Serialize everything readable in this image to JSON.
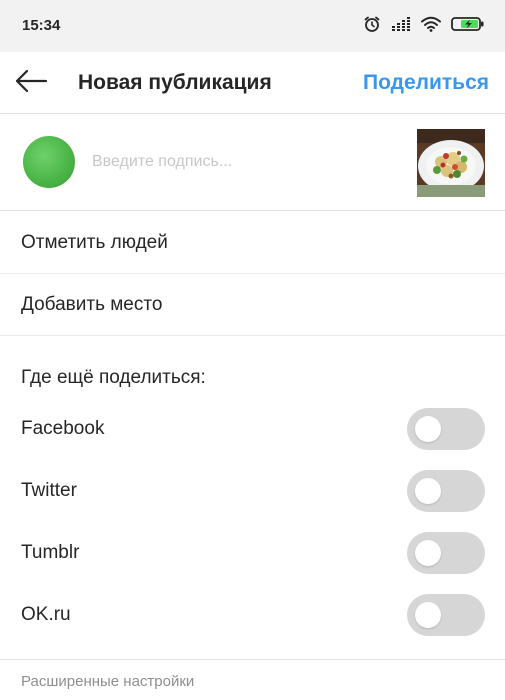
{
  "status_bar": {
    "time": "15:34",
    "icons": [
      "alarm-icon",
      "signal-icon",
      "wifi-icon",
      "battery-charging-icon"
    ]
  },
  "header": {
    "back_icon": "arrow-left-icon",
    "title": "Новая публикация",
    "share_label": "Поделиться",
    "accent_color": "#3897f0"
  },
  "caption": {
    "placeholder": "Введите подпись...",
    "value": "",
    "avatar_color": "#4cb648"
  },
  "options": {
    "tag_people": "Отметить людей",
    "add_location": "Добавить место"
  },
  "share_section": {
    "title": "Где ещё поделиться:",
    "networks": [
      {
        "label": "Facebook",
        "enabled": false
      },
      {
        "label": "Twitter",
        "enabled": false
      },
      {
        "label": "Tumblr",
        "enabled": false
      },
      {
        "label": "OK.ru",
        "enabled": false
      }
    ]
  },
  "advanced_label": "Расширенные настройки"
}
